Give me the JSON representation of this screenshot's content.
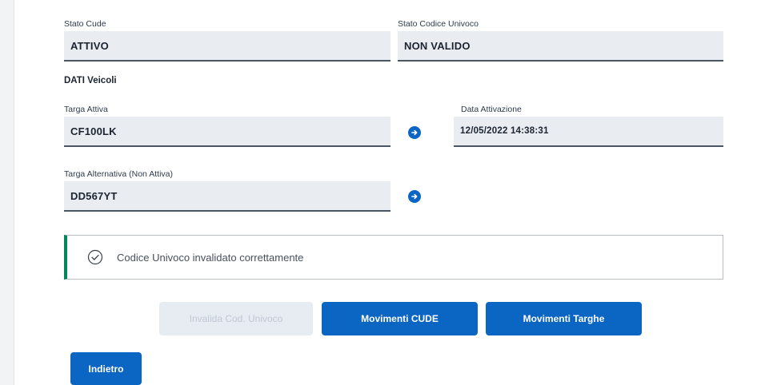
{
  "stato_cude": {
    "label": "Stato Cude",
    "value": "ATTIVO"
  },
  "stato_codice_univoco": {
    "label": "Stato Codice Univoco",
    "value": "NON VALIDO"
  },
  "dati_veicoli": {
    "title": "DATI Veicoli",
    "targa_attiva": {
      "label": "Targa Attiva",
      "value": "CF100LK"
    },
    "data_attivazione": {
      "label": "Data Attivazione",
      "value": "12/05/2022 14:38:31"
    },
    "targa_alternativa": {
      "label": "Targa Alternativa (Non Attiva)",
      "value": "DD567YT"
    }
  },
  "alert": {
    "message": "Codice Univoco invalidato correttamente",
    "status_color": "#008758"
  },
  "buttons": {
    "invalida": "Invalida Cod. Univoco",
    "movimenti_cude": "Movimenti CUDE",
    "movimenti_targhe": "Movimenti Targhe",
    "indietro": "Indietro"
  },
  "colors": {
    "primary": "#0a66c2",
    "field_bg": "#e9edf2",
    "field_border": "#4a5563"
  }
}
